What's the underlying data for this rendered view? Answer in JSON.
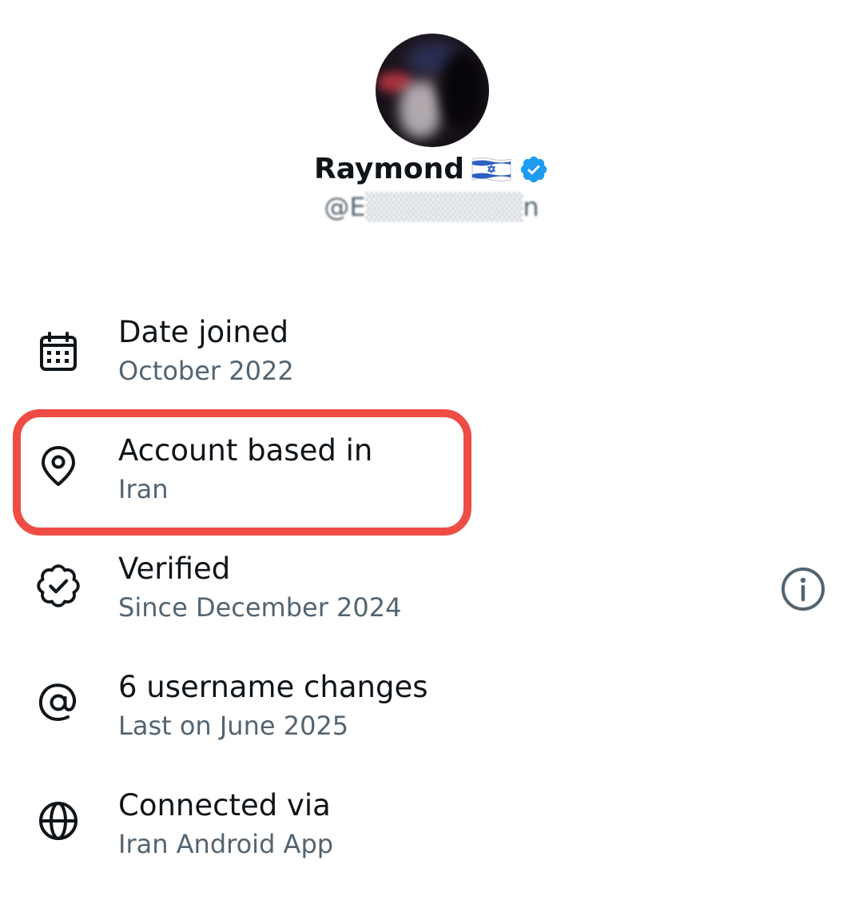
{
  "profile": {
    "display_name": "Raymond",
    "flag": "israel-flag",
    "verified_badge": "blue-checkmark",
    "handle": "@E",
    "handle_suffix": "n",
    "accent_color": "#1d9bf0"
  },
  "about": {
    "items": [
      {
        "icon": "calendar-icon",
        "title": "Date joined",
        "subtitle": "October 2022"
      },
      {
        "icon": "location-pin-icon",
        "title": "Account based in",
        "subtitle": "Iran"
      },
      {
        "icon": "verified-badge-outline-icon",
        "title": "Verified",
        "subtitle": "Since December 2024",
        "info_icon": "info-icon"
      },
      {
        "icon": "at-sign-icon",
        "title": "6 username changes",
        "subtitle": "Last on June 2025"
      },
      {
        "icon": "globe-icon",
        "title": "Connected via",
        "subtitle": "Iran Android App"
      }
    ]
  },
  "annotation": {
    "highlight_color": "#ee4c44",
    "highlighted_item": "Account based in"
  },
  "colors": {
    "primary_text": "#0f1419",
    "secondary_text": "#536471"
  }
}
